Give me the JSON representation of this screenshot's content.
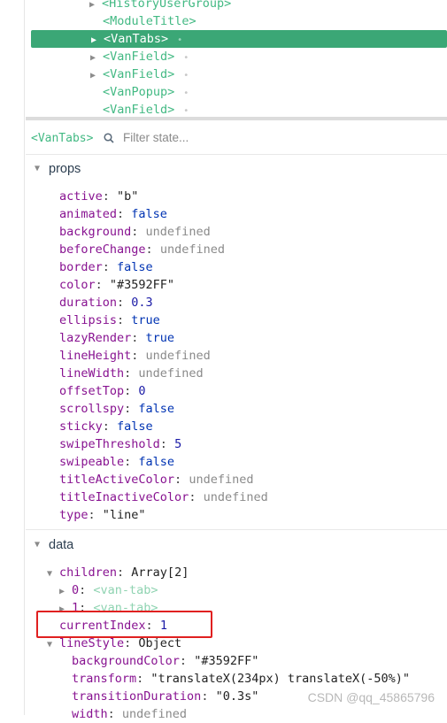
{
  "tree": {
    "rows": [
      {
        "label": "<HistoryUserGroup>",
        "expandable": true
      },
      {
        "label": "<ModuleTitle>",
        "expandable": false
      },
      {
        "label": "<VanTabs>",
        "expandable": true,
        "selected": true
      },
      {
        "label": "<VanField>",
        "expandable": true
      },
      {
        "label": "<VanField>",
        "expandable": true
      },
      {
        "label": "<VanPopup>",
        "expandable": false
      },
      {
        "label": "<VanField>",
        "expandable": false
      }
    ]
  },
  "filter_bar": {
    "component_tag": "<VanTabs>",
    "placeholder": "Filter state..."
  },
  "props": {
    "title": "props",
    "items": [
      {
        "key": "active",
        "value": "\"b\"",
        "type": "string"
      },
      {
        "key": "animated",
        "value": "false",
        "type": "bool"
      },
      {
        "key": "background",
        "value": "undefined",
        "type": "undefined"
      },
      {
        "key": "beforeChange",
        "value": "undefined",
        "type": "undefined"
      },
      {
        "key": "border",
        "value": "false",
        "type": "bool"
      },
      {
        "key": "color",
        "value": "\"#3592FF\"",
        "type": "string"
      },
      {
        "key": "duration",
        "value": "0.3",
        "type": "number"
      },
      {
        "key": "ellipsis",
        "value": "true",
        "type": "bool"
      },
      {
        "key": "lazyRender",
        "value": "true",
        "type": "bool"
      },
      {
        "key": "lineHeight",
        "value": "undefined",
        "type": "undefined"
      },
      {
        "key": "lineWidth",
        "value": "undefined",
        "type": "undefined"
      },
      {
        "key": "offsetTop",
        "value": "0",
        "type": "number"
      },
      {
        "key": "scrollspy",
        "value": "false",
        "type": "bool"
      },
      {
        "key": "sticky",
        "value": "false",
        "type": "bool"
      },
      {
        "key": "swipeThreshold",
        "value": "5",
        "type": "number"
      },
      {
        "key": "swipeable",
        "value": "false",
        "type": "bool"
      },
      {
        "key": "titleActiveColor",
        "value": "undefined",
        "type": "undefined"
      },
      {
        "key": "titleInactiveColor",
        "value": "undefined",
        "type": "undefined"
      },
      {
        "key": "type",
        "value": "\"line\"",
        "type": "string"
      }
    ]
  },
  "data": {
    "title": "data",
    "children": {
      "key": "children",
      "value": "Array[2]"
    },
    "child_items": [
      {
        "key": "0",
        "value": "<van-tab>"
      },
      {
        "key": "1",
        "value": "<van-tab>"
      }
    ],
    "current_index": {
      "key": "currentIndex",
      "value": "1"
    },
    "line_style": {
      "key": "lineStyle",
      "value": "Object"
    },
    "line_style_items": [
      {
        "key": "backgroundColor",
        "value": "\"#3592FF\"",
        "type": "string"
      },
      {
        "key": "transform",
        "value": "\"translateX(234px) translateX(-50%)\"",
        "type": "string"
      },
      {
        "key": "transitionDuration",
        "value": "\"0.3s\"",
        "type": "string"
      },
      {
        "key": "width",
        "value": "undefined",
        "type": "undefined"
      }
    ]
  },
  "watermark": "CSDN @qq_45865796",
  "colors": {
    "accent_green": "#42b983",
    "selected_row": "#3ba776",
    "key_purple": "#881391",
    "highlight_red": "#e02020"
  }
}
